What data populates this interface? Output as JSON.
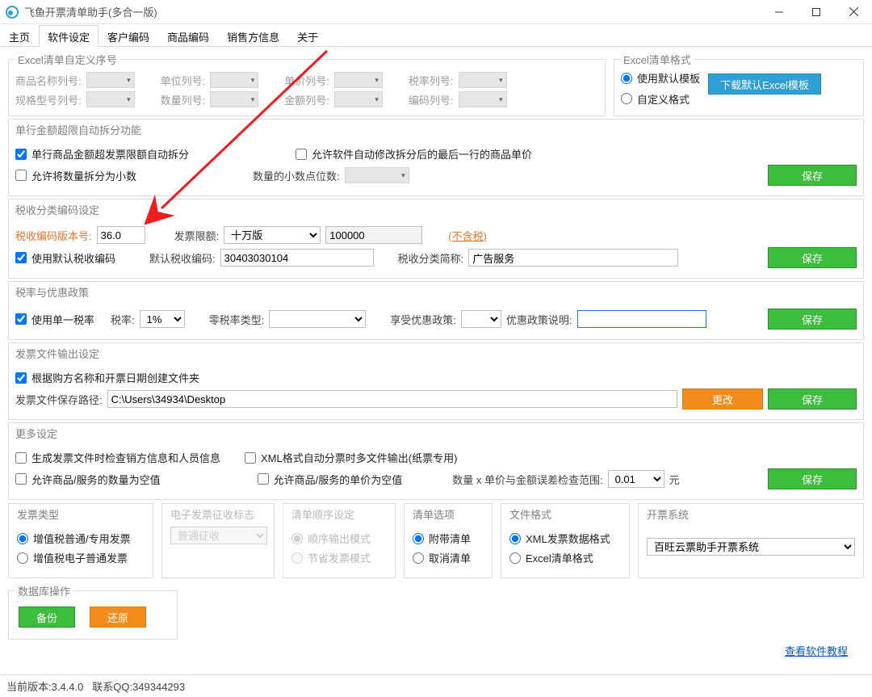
{
  "window": {
    "title": "飞鱼开票清单助手(多合一版)"
  },
  "tabs": [
    "主页",
    "软件设定",
    "客户编码",
    "商品编码",
    "销售方信息",
    "关于"
  ],
  "excel_seq": {
    "legend": "Excel清单自定义序号",
    "labels": {
      "name": "商品名称列号:",
      "unit": "单位列号:",
      "price": "单价列号:",
      "rate": "税率列号:",
      "spec": "规格型号列号:",
      "qty": "数量列号:",
      "amount": "金额列号:",
      "code": "编码列号:"
    }
  },
  "excel_fmt": {
    "legend": "Excel清单格式",
    "opt_default": "使用默认模板",
    "opt_custom": "自定义格式",
    "download_btn": "下载默认Excel模板"
  },
  "split": {
    "legend": "单行金额超限自动拆分功能",
    "chk_auto": "单行商品金额超发票限额自动拆分",
    "chk_dec": "允许将数量拆分为小数",
    "chk_modify": "允许软件自动修改拆分后的最后一行的商品单价",
    "dec_label": "数量的小数点位数:",
    "save": "保存"
  },
  "taxcode": {
    "legend": "税收分类编码设定",
    "version_label": "税收编码版本号:",
    "version_value": "36.0",
    "limit_label": "发票限额:",
    "limit_sel": "十万版",
    "limit_value": "100000",
    "limit_note": "(不含税)",
    "chk_default": "使用默认税收编码",
    "default_label": "默认税收编码:",
    "default_value": "30403030104",
    "short_label": "税收分类简称:",
    "short_value": "广告服务",
    "save": "保存"
  },
  "rate": {
    "legend": "税率与优惠政策",
    "chk_single": "使用单一税率",
    "rate_label": "税率:",
    "rate_value": "1%",
    "zero_label": "零税率类型:",
    "policy_label": "享受优惠政策:",
    "desc_label": "优惠政策说明:",
    "desc_value": "",
    "save": "保存"
  },
  "output": {
    "legend": "发票文件输出设定",
    "chk_folder": "根据购方名称和开票日期创建文件夹",
    "path_label": "发票文件保存路径:",
    "path_value": "C:\\Users\\34934\\Desktop",
    "change": "更改",
    "save": "保存"
  },
  "more": {
    "legend": "更多设定",
    "chk_seller": "生成发票文件时检查销方信息和人员信息",
    "chk_xml": "XML格式自动分票时多文件输出(纸票专用)",
    "chk_qtynull": "允许商品/服务的数量为空值",
    "chk_pricenull": "允许商品/服务的单价为空值",
    "err_label": "数量 x 单价与金额误差检查范围:",
    "err_value": "0.01",
    "err_unit": "元",
    "save": "保存"
  },
  "groups": {
    "invoice_type": {
      "title": "发票类型",
      "opt1": "增值税普通/专用发票",
      "opt2": "增值税电子普通发票"
    },
    "einvoice": {
      "title": "电子发票征收标志",
      "sel": "普通征收"
    },
    "order": {
      "title": "清单顺序设定",
      "opt1": "顺序输出模式",
      "opt2": "节省发票模式"
    },
    "listopt": {
      "title": "清单选项",
      "opt1": "附带清单",
      "opt2": "取消清单"
    },
    "fileformat": {
      "title": "文件格式",
      "opt1": "XML发票数据格式",
      "opt2": "Excel清单格式"
    },
    "system": {
      "title": "开票系统",
      "sel": "百旺云票助手开票系统"
    }
  },
  "db": {
    "legend": "数据库操作",
    "backup": "备份",
    "restore": "还原"
  },
  "link": "查看软件教程",
  "status": {
    "version": "当前版本:3.4.4.0",
    "qq": "联系QQ:349344293"
  }
}
